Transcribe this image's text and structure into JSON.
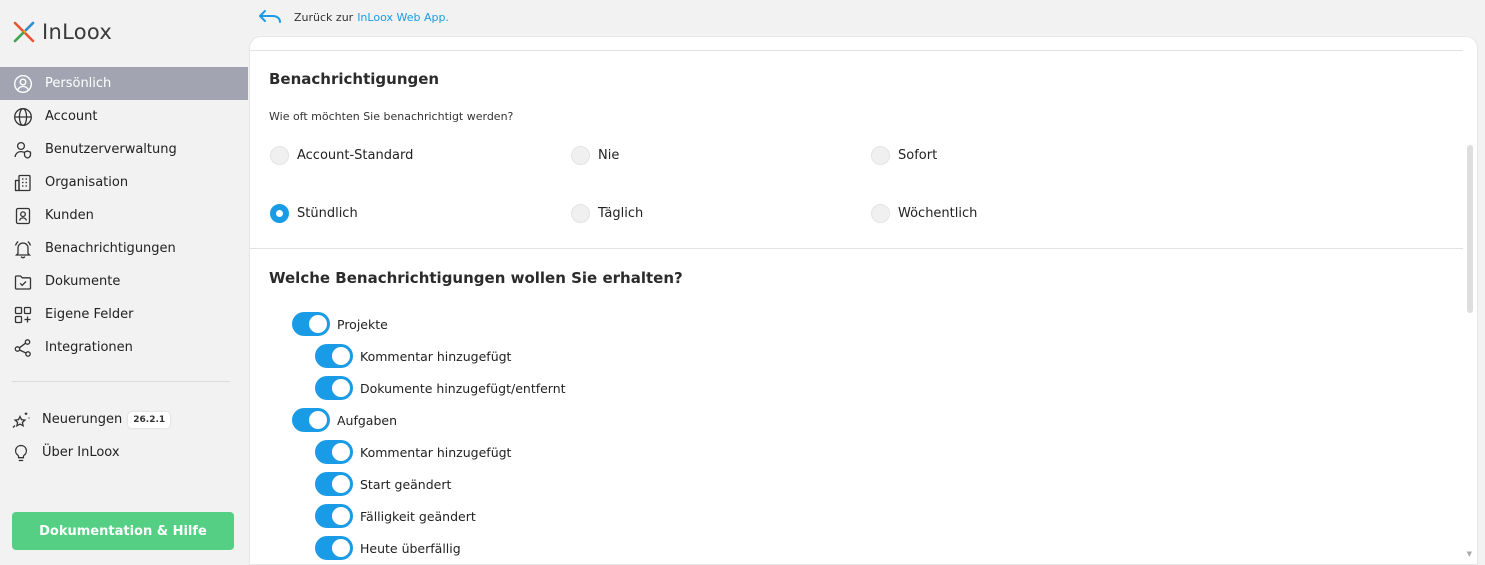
{
  "brand": {
    "name": "InLoox"
  },
  "back": {
    "prefix": "Zurück zur",
    "link": "InLoox Web App."
  },
  "sidebar": {
    "items": [
      {
        "label": "Persönlich",
        "icon": "user-circle-icon",
        "active": true
      },
      {
        "label": "Account",
        "icon": "globe-icon"
      },
      {
        "label": "Benutzerverwaltung",
        "icon": "user-shield-icon"
      },
      {
        "label": "Organisation",
        "icon": "building-icon"
      },
      {
        "label": "Kunden",
        "icon": "contact-book-icon"
      },
      {
        "label": "Benachrichtigungen",
        "icon": "bell-icon"
      },
      {
        "label": "Dokumente",
        "icon": "folder-check-icon"
      },
      {
        "label": "Eigene Felder",
        "icon": "grid-plus-icon"
      },
      {
        "label": "Integrationen",
        "icon": "share-nodes-icon"
      }
    ],
    "extra": [
      {
        "label": "Neuerungen",
        "icon": "sparkle-star-icon",
        "badge": "26.2.1"
      },
      {
        "label": "Über InLoox",
        "icon": "lightbulb-icon"
      }
    ],
    "help_button": "Dokumentation & Hilfe"
  },
  "notifications": {
    "title": "Benachrichtigungen",
    "question": "Wie oft möchten Sie benachrichtigt werden?",
    "options": [
      "Account-Standard",
      "Nie",
      "Sofort",
      "Stündlich",
      "Täglich",
      "Wöchentlich"
    ],
    "selected": "Stündlich"
  },
  "types": {
    "title": "Welche Benachrichtigungen wollen Sie erhalten?",
    "toggles": [
      {
        "label": "Projekte",
        "on": true,
        "level": 0
      },
      {
        "label": "Kommentar hinzugefügt",
        "on": true,
        "level": 1
      },
      {
        "label": "Dokumente hinzugefügt/entfernt",
        "on": true,
        "level": 1
      },
      {
        "label": "Aufgaben",
        "on": true,
        "level": 0
      },
      {
        "label": "Kommentar hinzugefügt",
        "on": true,
        "level": 1
      },
      {
        "label": "Start geändert",
        "on": true,
        "level": 1
      },
      {
        "label": "Fälligkeit geändert",
        "on": true,
        "level": 1
      },
      {
        "label": "Heute überfällig",
        "on": true,
        "level": 1
      }
    ]
  },
  "colors": {
    "accent": "#1a9be6",
    "active_nav": "#a2a5b1",
    "help_button": "#55cf83"
  }
}
